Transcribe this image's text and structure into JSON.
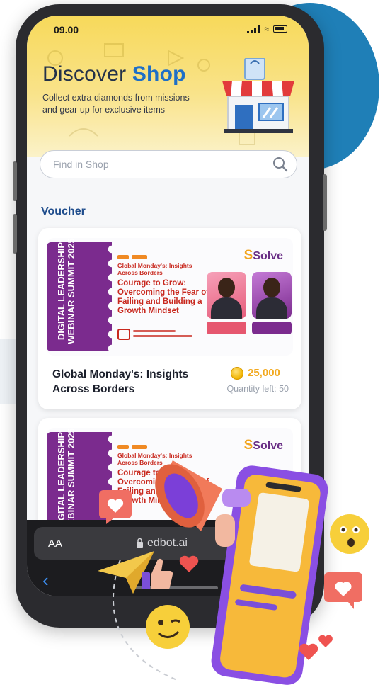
{
  "status_bar": {
    "time": "09.00"
  },
  "header": {
    "title_prefix": "Discover ",
    "title_accent": "Shop",
    "subtitle": "Collect extra diamonds from missions and gear up for exclusive items"
  },
  "search": {
    "placeholder": "Find in Shop"
  },
  "section": {
    "title": "Voucher"
  },
  "vouchers": [
    {
      "banner": {
        "ribbon": "DIGITAL LEADERSHIP WEBINAR SUMMIT 2025",
        "subtitle": "Global Monday's: Insights Across Borders",
        "heading": "Courage to Grow: Overcoming the Fear of Failing and Building a Growth Mindset",
        "logo": "Solve"
      },
      "name": "Global Monday's: Insights Across Borders",
      "price": "25,000",
      "quantity": "Quantity left: 50"
    },
    {
      "banner": {
        "ribbon": "DIGITAL LEADERSHIP WEBINAR SUMMIT 2025",
        "subtitle": "Global Monday's: Insights Across Borders",
        "heading": "Courage to Grow: Overcoming the Fear of Failing and Building a Growth Mindset",
        "logo": "Solve"
      }
    }
  ],
  "browser": {
    "text_size": "AA",
    "url": "edbot.ai"
  },
  "colors": {
    "accent": "#1e6fc7",
    "ribbon": "#7b2b8e",
    "price": "#f2a91f",
    "background_circle": "#1f7fb7"
  },
  "icons": [
    "search-icon",
    "lock-icon",
    "back-icon",
    "coin-icon",
    "megaphone-icon",
    "paper-plane-icon",
    "heart-icon",
    "emoji-icon"
  ]
}
